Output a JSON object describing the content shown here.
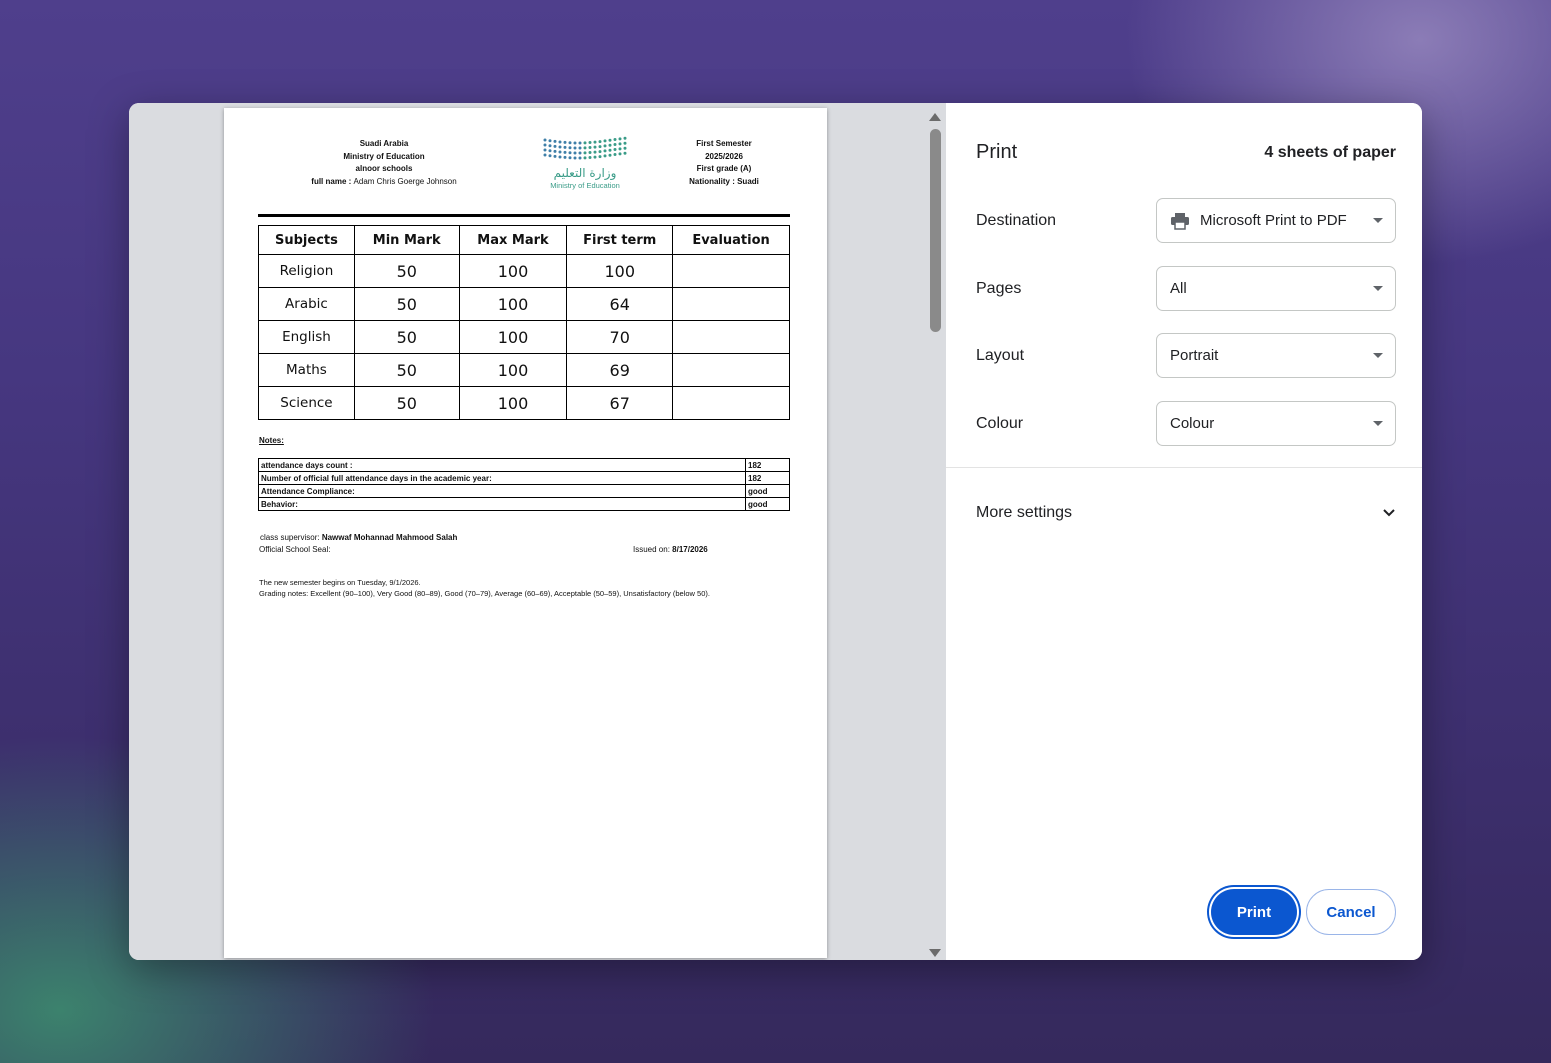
{
  "report": {
    "header_left": {
      "country": "Suadi Arabia",
      "ministry": "Ministry of Education",
      "school": "alnoor schools",
      "full_name_label": "full name :",
      "full_name_value": "Adam Chris Goerge Johnson"
    },
    "logo": {
      "arabic": "وزارة التعليم",
      "english": "Ministry of Education",
      "color": "#3a9c88"
    },
    "header_right": {
      "semester": "First Semester",
      "year": "2025/2026",
      "grade": "First grade (A)",
      "nationality": "Nationality : Suadi"
    },
    "marks_table": {
      "headers": [
        "Subjects",
        "Min Mark",
        "Max Mark",
        "First term",
        "Evaluation"
      ],
      "rows": [
        [
          "Religion",
          "50",
          "100",
          "100",
          ""
        ],
        [
          "Arabic",
          "50",
          "100",
          "64",
          ""
        ],
        [
          "English",
          "50",
          "100",
          "70",
          ""
        ],
        [
          "Maths",
          "50",
          "100",
          "69",
          ""
        ],
        [
          "Science",
          "50",
          "100",
          "67",
          ""
        ]
      ]
    },
    "notes_label": "Notes:",
    "attendance": [
      [
        "attendance days count :",
        "182"
      ],
      [
        "Number of official full attendance days in the academic year:",
        "182"
      ],
      [
        "Attendance Compliance:",
        "good"
      ],
      [
        "Behavior:",
        "good"
      ]
    ],
    "supervisor_label": "class supervisor:",
    "supervisor_name": "Nawwaf Mohannad Mahmood Salah",
    "seal_label": "Official School Seal:",
    "issued_label": "Issued on:",
    "issued_date": "8/17/2026",
    "note_semester": "The new semester begins on Tuesday, 9/1/2026.",
    "note_grading": "Grading notes: Excellent (90–100), Very Good (80–89), Good (70–79), Average (60–69), Acceptable (50–59), Unsatisfactory (below 50)."
  },
  "print_panel": {
    "title": "Print",
    "sheets": "4 sheets of paper",
    "destination_label": "Destination",
    "destination_value": "Microsoft Print to PDF",
    "pages_label": "Pages",
    "pages_value": "All",
    "layout_label": "Layout",
    "layout_value": "Portrait",
    "colour_label": "Colour",
    "colour_value": "Colour",
    "more_settings": "More settings",
    "print_button": "Print",
    "cancel_button": "Cancel",
    "accent_color": "#0b57d0"
  }
}
